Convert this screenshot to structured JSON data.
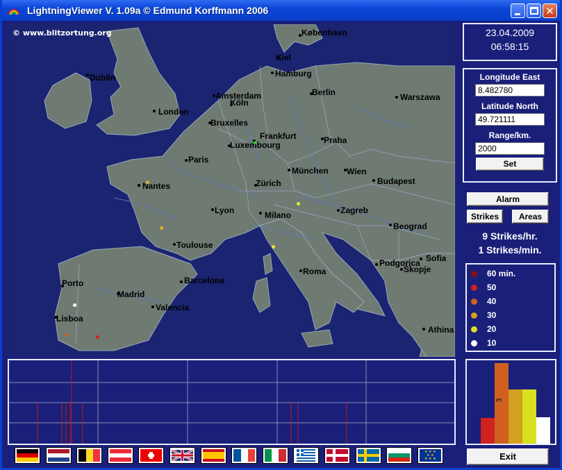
{
  "window": {
    "title": "LightningViewer V. 1.09a  © Edmund Korffmann 2006",
    "icon": "rainbow-icon"
  },
  "map": {
    "copyright": "© www.blitzortung.org",
    "cities": [
      "København",
      "Kiel",
      "Dublin",
      "Hamburg",
      "Berlin",
      "Amsterdam",
      "Warszawa",
      "London",
      "Köln",
      "Bruxelles",
      "Frankfurt",
      "Praha",
      "Luxembourg",
      "Paris",
      "München",
      "Wien",
      "Nantes",
      "Zürich",
      "Budapest",
      "Lyon",
      "Milano",
      "Zagreb",
      "Beograd",
      "Toulouse",
      "Sofia",
      "Podgorica",
      "Skopje",
      "Roma",
      "Porto",
      "Barcelona",
      "Madrid",
      "Valencia",
      "Lisboa",
      "Athina"
    ],
    "strike_colors": [
      "#ffffff",
      "#e8e840",
      "#e0b020",
      "#d06020",
      "#d02020",
      "#22cc22"
    ]
  },
  "datetime": {
    "date": "23.04.2009",
    "time": "06:58:15"
  },
  "position": {
    "longitude_label": "Longitude East",
    "longitude_value": "8.482780",
    "latitude_label": "Latitude North",
    "latitude_value": "49.721111",
    "range_label": "Range/km.",
    "range_value": "2000",
    "set_label": "Set"
  },
  "buttons": {
    "alarm": "Alarm",
    "strikes": "Strikes",
    "areas": "Areas",
    "exit": "Exit"
  },
  "rates": {
    "per_hour": "9 Strikes/hr.",
    "per_minute": "1 Strikes/min."
  },
  "legend": [
    {
      "label": "60 min.",
      "color": "#8a1010"
    },
    {
      "label": "50",
      "color": "#d02020"
    },
    {
      "label": "40",
      "color": "#d06020"
    },
    {
      "label": "30",
      "color": "#d4a020"
    },
    {
      "label": "20",
      "color": "#d8e020"
    },
    {
      "label": "10",
      "color": "#ffffff"
    }
  ],
  "age_histogram": {
    "bars": [
      {
        "color": "#d02020",
        "level": 0.31
      },
      {
        "color": "#d06020",
        "level": 0.97,
        "label": "3"
      },
      {
        "color": "#d4a020",
        "level": 0.65
      },
      {
        "color": "#d8e020",
        "level": 0.65
      },
      {
        "color": "#ffffff",
        "level": 0.32
      }
    ]
  },
  "flags": [
    "flag-germany",
    "flag-netherlands",
    "flag-belgium",
    "flag-austria",
    "flag-switzerland",
    "flag-united-kingdom",
    "flag-spain",
    "flag-france",
    "flag-italy",
    "flag-greece",
    "flag-denmark",
    "flag-sweden",
    "flag-bulgaria",
    "flag-european-union"
  ]
}
